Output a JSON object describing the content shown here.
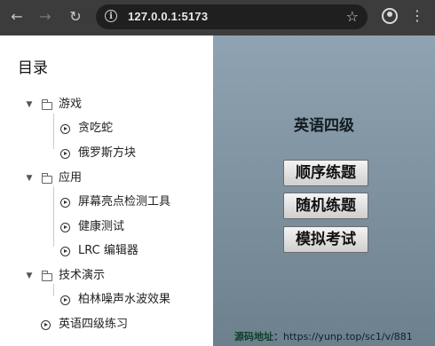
{
  "browser": {
    "url": "127.0.0.1:5173",
    "back_icon": "←",
    "forward_icon": "→",
    "reload_icon": "↻",
    "star_icon": "☆",
    "menu_icon": "⋮"
  },
  "sidebar": {
    "title": "目录",
    "groups": [
      {
        "label": "游戏",
        "items": [
          "贪吃蛇",
          "俄罗斯方块"
        ]
      },
      {
        "label": "应用",
        "items": [
          "屏幕亮点检测工具",
          "健康测试",
          "LRC 编辑器"
        ]
      },
      {
        "label": "技术演示",
        "items": [
          "柏林噪声水波效果"
        ]
      }
    ],
    "root_item": "英语四级练习"
  },
  "main": {
    "title": "英语四级",
    "buttons": [
      "顺序练题",
      "随机练题",
      "模拟考试"
    ],
    "footer_label": "源码地址：",
    "footer_url": "https://yunp.top/sc1/v/881"
  }
}
